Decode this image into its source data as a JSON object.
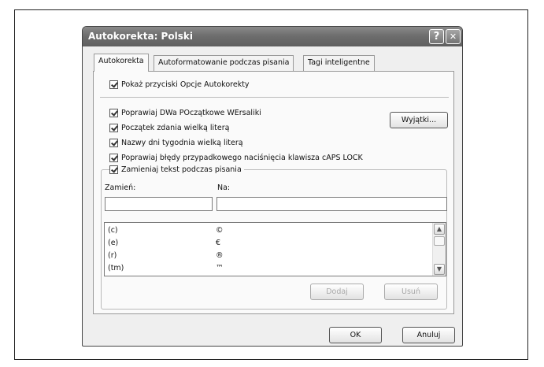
{
  "dialog": {
    "title": "Autokorekta: Polski",
    "help_button": "?",
    "close_button": "✕"
  },
  "tabs": [
    {
      "label": "Autokorekta",
      "active": true
    },
    {
      "label": "Autoformatowanie podczas pisania",
      "active": false
    },
    {
      "label": "Tagi inteligentne",
      "active": false
    }
  ],
  "options": {
    "show_buttons": "Pokaż przyciski Opcje Autokorekty",
    "two_initial_caps": "Poprawiaj DWa POczątkowe WErsaliki",
    "sentence_capital": "Początek zdania wielką literą",
    "day_names": "Nazwy dni tygodnia wielką literą",
    "caps_lock": "Poprawiaj błędy przypadkowego naciśnięcia klawisza cAPS LOCK",
    "replace_text": "Zamieniaj tekst podczas pisania"
  },
  "exceptions_button": "Wyjątki...",
  "replace": {
    "replace_label": "Zamień:",
    "with_label": "Na:",
    "replace_value": "",
    "with_value": "",
    "rows": [
      {
        "from": "(c)",
        "to": "©"
      },
      {
        "from": "(e)",
        "to": "€"
      },
      {
        "from": "(r)",
        "to": "®"
      },
      {
        "from": "(tm)",
        "to": "™"
      }
    ],
    "add_button": "Dodaj",
    "delete_button": "Usuń"
  },
  "footer": {
    "ok_button": "OK",
    "cancel_button": "Anuluj"
  },
  "icons": {
    "scroll_up": "chevron-up-icon",
    "scroll_down": "chevron-down-icon",
    "checked": "checkbox-checked-icon"
  }
}
